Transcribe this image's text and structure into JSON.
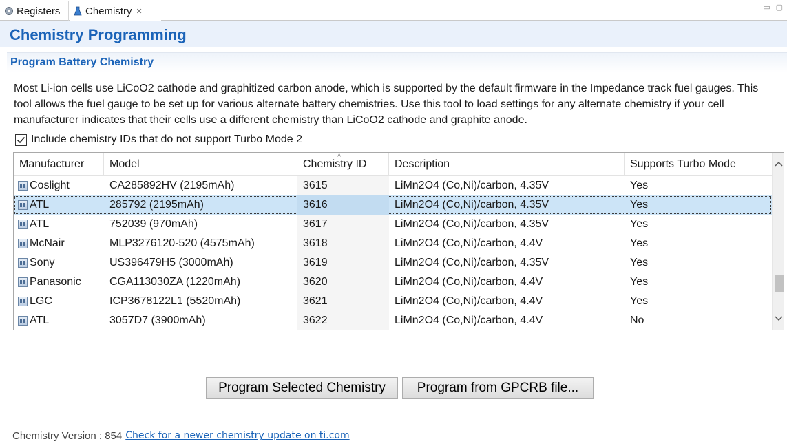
{
  "tabs": [
    {
      "label": "Registers",
      "icon": "gear-icon",
      "active": false
    },
    {
      "label": "Chemistry",
      "icon": "flask-icon",
      "active": true
    }
  ],
  "page": {
    "title": "Chemistry Programming",
    "section_title": "Program Battery Chemistry",
    "description": "Most Li-ion cells use LiCoO2 cathode and graphitized carbon anode, which is supported by the default firmware in the Impedance track fuel gauges. This tool allows the fuel gauge to be set up for various alternate battery chemistries. Use this tool to load settings for any alternate chemistry if your cell manufacturer indicates that their cells use a different chemistry than LiCoO2 cathode and graphite anode.",
    "checkbox_label": "Include chemistry IDs that do not support Turbo Mode 2",
    "checkbox_checked": true
  },
  "table": {
    "columns": [
      "Manufacturer",
      "Model",
      "Chemistry ID",
      "Description",
      "Supports Turbo Mode"
    ],
    "rows": [
      {
        "manufacturer": "Coslight",
        "model": "CA285892HV (2195mAh)",
        "id": "3615",
        "description": "LiMn2O4 (Co,Ni)/carbon, 4.35V",
        "turbo": "Yes"
      },
      {
        "manufacturer": "ATL",
        "model": "285792 (2195mAh)",
        "id": "3616",
        "description": "LiMn2O4 (Co,Ni)/carbon, 4.35V",
        "turbo": "Yes",
        "selected": true
      },
      {
        "manufacturer": "ATL",
        "model": "752039 (970mAh)",
        "id": "3617",
        "description": "LiMn2O4 (Co,Ni)/carbon, 4.35V",
        "turbo": "Yes"
      },
      {
        "manufacturer": "McNair",
        "model": "MLP3276120-520 (4575mAh)",
        "id": "3618",
        "description": "LiMn2O4 (Co,Ni)/carbon, 4.4V",
        "turbo": "Yes"
      },
      {
        "manufacturer": "Sony",
        "model": "US396479H5 (3000mAh)",
        "id": "3619",
        "description": "LiMn2O4 (Co,Ni)/carbon, 4.35V",
        "turbo": "Yes"
      },
      {
        "manufacturer": "Panasonic",
        "model": "CGA113030ZA (1220mAh)",
        "id": "3620",
        "description": "LiMn2O4 (Co,Ni)/carbon, 4.4V",
        "turbo": "Yes"
      },
      {
        "manufacturer": "LGC",
        "model": "ICP3678122L1 (5520mAh)",
        "id": "3621",
        "description": "LiMn2O4 (Co,Ni)/carbon, 4.4V",
        "turbo": "Yes"
      },
      {
        "manufacturer": "ATL",
        "model": "3057D7 (3900mAh)",
        "id": "3622",
        "description": "LiMn2O4 (Co,Ni)/carbon, 4.4V",
        "turbo": "No"
      }
    ],
    "scroll_position": 0.84,
    "scroll_visible_fraction": 0.12
  },
  "buttons": {
    "program_selected": "Program Selected Chemistry",
    "program_gpcrb": "Program from GPCRB file..."
  },
  "footer": {
    "version_text": "Chemistry Version : 854",
    "update_link": "Check for a newer chemistry update on ti.com"
  },
  "colors": {
    "accent": "#1a63b8",
    "selection": "#cce4f7"
  }
}
